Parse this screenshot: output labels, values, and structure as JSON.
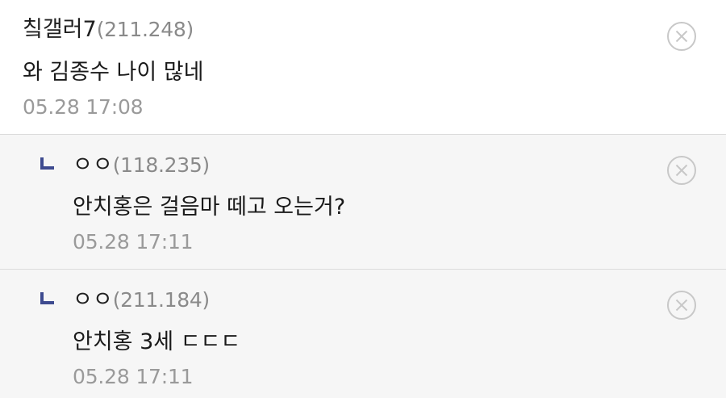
{
  "comments": [
    {
      "author": "칰갤러7",
      "ip": "(211.248)",
      "text": "와 김종수 나이 많네",
      "time": "05.28 17:08",
      "delete_icon": "close-circle-icon"
    }
  ],
  "replies": [
    {
      "reply_icon": "reply-arrow-icon",
      "author": "ㅇㅇ",
      "ip": "(118.235)",
      "text": "안치홍은 걸음마 떼고 오는거?",
      "time": "05.28 17:11",
      "delete_icon": "close-circle-icon"
    },
    {
      "reply_icon": "reply-arrow-icon",
      "author": "ㅇㅇ",
      "ip": "(211.184)",
      "text": "안치홍 3세 ㄷㄷㄷ",
      "time": "05.28 17:11",
      "delete_icon": "close-circle-icon"
    }
  ],
  "colors": {
    "reply_icon": "#3d4a8f",
    "ip_text": "#8a8a8a",
    "time_text": "#9a9a9a",
    "delete_icon": "#c8c8c8",
    "reply_background": "#f6f6f6"
  }
}
